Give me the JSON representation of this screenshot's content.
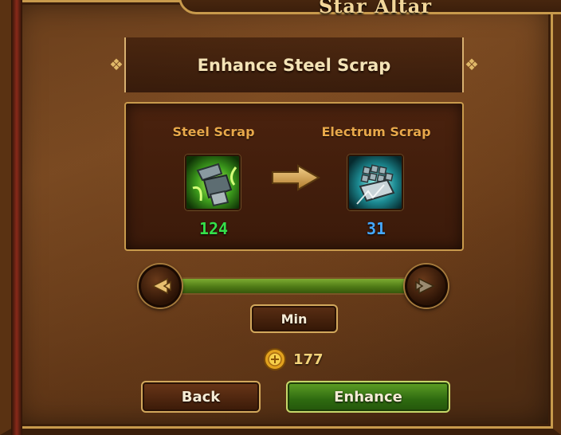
{
  "window": {
    "title": "Star Altar"
  },
  "dialog": {
    "title": "Enhance Steel Scrap",
    "source": {
      "label": "Steel Scrap",
      "count": "124",
      "icon": "steel-scrap-icon",
      "count_color": "#35e04a"
    },
    "target": {
      "label": "Electrum Scrap",
      "count": "31",
      "icon": "electrum-scrap-icon",
      "count_color": "#45a8ff"
    },
    "conversion_arrow_icon": "arrow-right-icon"
  },
  "slider": {
    "fill_fraction": 1.0,
    "decrease_icon": "arrow-left-icon",
    "increase_icon": "arrow-right-icon"
  },
  "buttons": {
    "min_label": "Min",
    "back_label": "Back",
    "enhance_label": "Enhance"
  },
  "cost": {
    "icon": "gold-coin-icon",
    "value": "177"
  },
  "colors": {
    "accent_gold": "#c89a4c",
    "enhance_green": "#2e6a10"
  }
}
